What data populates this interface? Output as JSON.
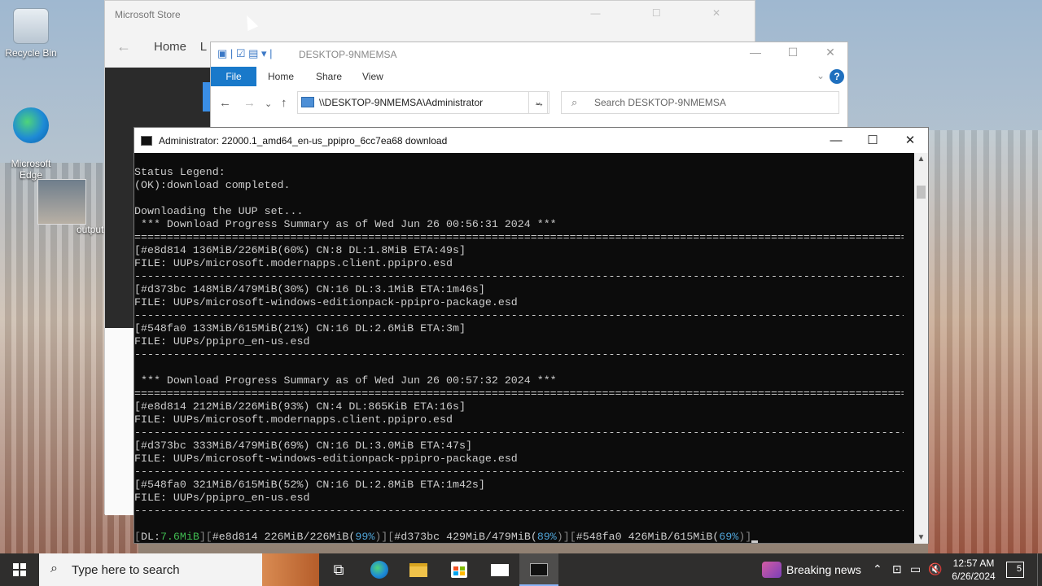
{
  "desktop": {
    "icons": [
      {
        "label": "Recycle Bin"
      },
      {
        "label": "Microsoft\nEdge"
      }
    ],
    "output_label": "output"
  },
  "store": {
    "title": "Microsoft Store",
    "nav_home": "Home",
    "nav_partial": "L"
  },
  "explorer": {
    "title": "DESKTOP-9NMEMSA",
    "tabs": [
      "File",
      "Home",
      "Share",
      "View"
    ],
    "address": "\\\\DESKTOP-9NMEMSA\\Administrator",
    "search_placeholder": "Search DESKTOP-9NMEMSA",
    "help": "?"
  },
  "cmd": {
    "title": "Administrator:  22000.1_amd64_en-us_ppipro_6cc7ea68 download",
    "lines": [
      "Status Legend:",
      "(OK):download completed.",
      "",
      "Downloading the UUP set...",
      " *** Download Progress Summary as of Wed Jun 26 00:56:31 2024 ***",
      "========================================================================================================================",
      "[#e8d814 136MiB/226MiB(60%) CN:8 DL:1.8MiB ETA:49s]",
      "FILE: UUPs/microsoft.modernapps.client.ppipro.esd",
      "------------------------------------------------------------------------------------------------------------------------",
      "[#d373bc 148MiB/479MiB(30%) CN:16 DL:3.1MiB ETA:1m46s]",
      "FILE: UUPs/microsoft-windows-editionpack-ppipro-package.esd",
      "------------------------------------------------------------------------------------------------------------------------",
      "[#548fa0 133MiB/615MiB(21%) CN:16 DL:2.6MiB ETA:3m]",
      "FILE: UUPs/ppipro_en-us.esd",
      "------------------------------------------------------------------------------------------------------------------------",
      "",
      " *** Download Progress Summary as of Wed Jun 26 00:57:32 2024 ***",
      "========================================================================================================================",
      "[#e8d814 212MiB/226MiB(93%) CN:4 DL:865KiB ETA:16s]",
      "FILE: UUPs/microsoft.modernapps.client.ppipro.esd",
      "------------------------------------------------------------------------------------------------------------------------",
      "[#d373bc 333MiB/479MiB(69%) CN:16 DL:3.0MiB ETA:47s]",
      "FILE: UUPs/microsoft-windows-editionpack-ppipro-package.esd",
      "------------------------------------------------------------------------------------------------------------------------",
      "[#548fa0 321MiB/615MiB(52%) CN:16 DL:2.8MiB ETA:1m42s]",
      "FILE: UUPs/ppipro_en-us.esd",
      "------------------------------------------------------------------------------------------------------------------------"
    ],
    "status": {
      "open": "[",
      "dl_label": "DL:",
      "dl_value": "7.6MiB",
      "sep1": "][",
      "item1": "#e8d814 226MiB/226MiB(",
      "item1_pct": "99%",
      "sep2": ")][",
      "item2": "#d373bc 429MiB/479MiB(",
      "item2_pct": "89%",
      "sep3": ")][",
      "item3": "#548fa0 426MiB/615MiB(",
      "item3_pct": "69%",
      "close": ")]"
    }
  },
  "taskbar": {
    "search_placeholder": "Type here to search",
    "news": "Breaking news",
    "time": "12:57 AM",
    "date": "6/26/2024",
    "notifications": "5"
  },
  "colors": {
    "console_bg": "#0c0c0c",
    "console_fg": "#cccccc",
    "accent": "#1979ca",
    "status_green": "#3fb950",
    "status_cyan": "#4fa3d6"
  }
}
